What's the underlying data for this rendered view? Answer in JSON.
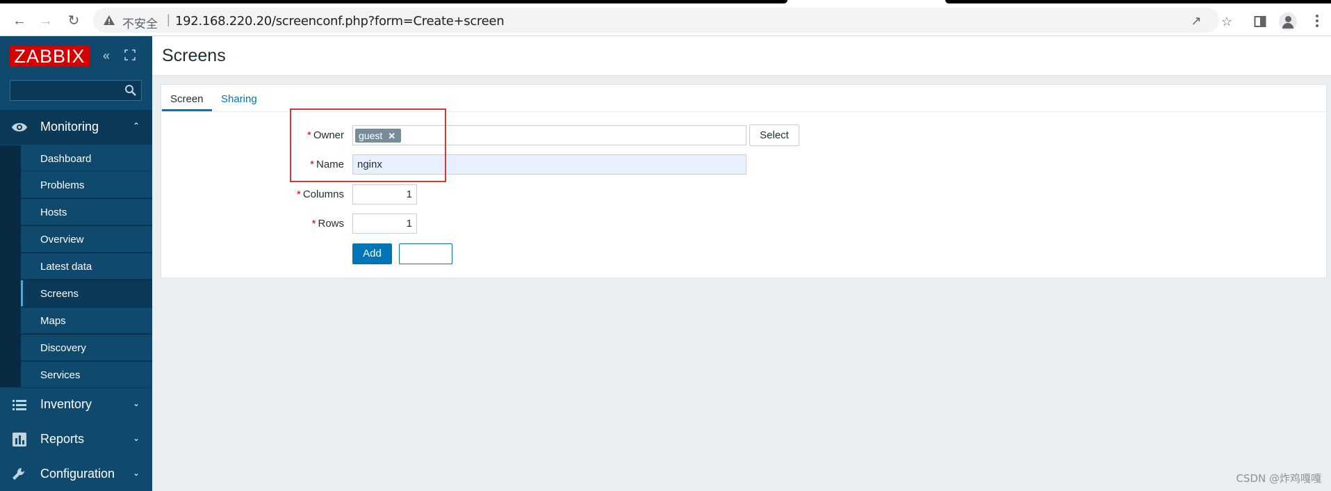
{
  "browser": {
    "insecure_label": "不安全",
    "separator": "|",
    "url": "192.168.220.20/screenconf.php?form=Create+screen"
  },
  "sidebar": {
    "logo": "ZABBIX",
    "search_placeholder": "",
    "menus": [
      {
        "label": "Monitoring",
        "icon": "eye-icon",
        "expanded": true
      },
      {
        "label": "Inventory",
        "icon": "list-icon",
        "expanded": false
      },
      {
        "label": "Reports",
        "icon": "bar-chart-icon",
        "expanded": false
      },
      {
        "label": "Configuration",
        "icon": "wrench-icon",
        "expanded": false
      }
    ],
    "monitoring_items": [
      "Dashboard",
      "Problems",
      "Hosts",
      "Overview",
      "Latest data",
      "Screens",
      "Maps",
      "Discovery",
      "Services"
    ],
    "active_item": "Screens"
  },
  "page": {
    "title": "Screens"
  },
  "tabs": [
    "Screen",
    "Sharing"
  ],
  "form": {
    "owner_label": "Owner",
    "owner_tag": "guest",
    "select_label": "Select",
    "name_label": "Name",
    "name_value": "nginx",
    "columns_label": "Columns",
    "columns_value": "1",
    "rows_label": "Rows",
    "rows_value": "1",
    "add_label": "Add",
    "cancel_label": ""
  },
  "watermark": "CSDN @炸鸡嘎嘎",
  "colors": {
    "sidebar": "#0f4a6e",
    "accent": "#0275b8",
    "logo": "#d40000",
    "highlight": "#e23131"
  }
}
